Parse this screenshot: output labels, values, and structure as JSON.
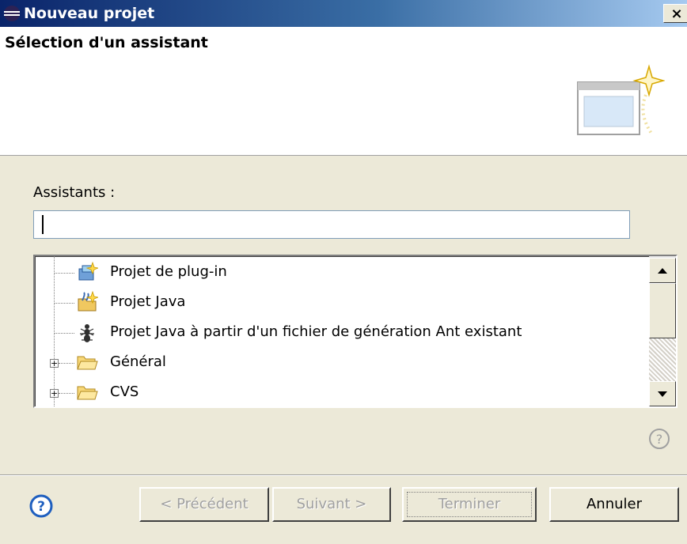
{
  "window": {
    "title": "Nouveau projet",
    "close_label": "×"
  },
  "header": {
    "title": "Sélection d'un assistant"
  },
  "filter": {
    "label": "Assistants :",
    "value": ""
  },
  "tree": {
    "items": [
      {
        "label": "Projet de plug-in",
        "icon": "plugin-project-icon",
        "expandable": false
      },
      {
        "label": "Projet Java",
        "icon": "java-project-icon",
        "expandable": false
      },
      {
        "label": "Projet Java à partir d'un fichier de génération Ant existant",
        "icon": "ant-icon",
        "expandable": false
      },
      {
        "label": "Général",
        "icon": "folder-icon",
        "expandable": true
      },
      {
        "label": "CVS",
        "icon": "folder-icon",
        "expandable": true
      }
    ]
  },
  "buttons": {
    "previous": "< Précédent",
    "next": "Suivant >",
    "finish": "Terminer",
    "cancel": "Annuler"
  },
  "colors": {
    "titlebar_start": "#0a246a",
    "titlebar_end": "#a6caf0",
    "dialog_bg": "#ece9d8",
    "help_blue": "#1f5fbf"
  }
}
